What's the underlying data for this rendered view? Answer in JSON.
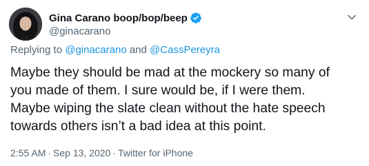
{
  "author": {
    "display_name": "Gina Carano boop/bop/beep",
    "handle": "@ginacarano",
    "verified": true
  },
  "reply": {
    "prefix": "Replying to",
    "mention_1": "@ginacarano",
    "conjunction": "and",
    "mention_2": "@CassPereyra"
  },
  "tweet": {
    "lines": [
      "Maybe they should be mad at the mockery so many of",
      "you made of them. I sure would be, if I were them.",
      "Maybe wiping the slate clean without the hate speech",
      "towards others isn’t a bad idea at this point."
    ]
  },
  "meta": {
    "time": "2:55 AM",
    "separator_1": "·",
    "date": "Sep 13, 2020",
    "separator_2": "·",
    "source": "Twitter for iPhone"
  },
  "colors": {
    "link": "#1b95e0",
    "verified_badge": "#1da1f2",
    "secondary_text": "#536471",
    "primary_text": "#0f1419"
  },
  "icons": {
    "verified": "verified-badge-icon",
    "more": "chevron-down-icon"
  }
}
